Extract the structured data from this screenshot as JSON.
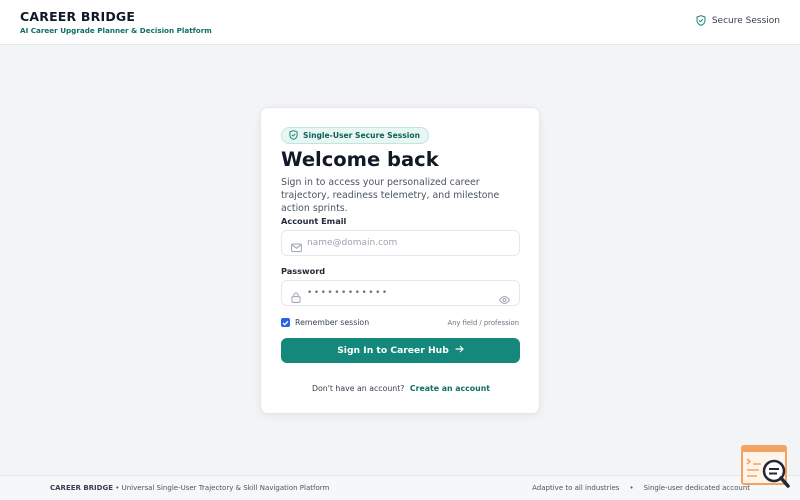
{
  "header": {
    "title": "CAREER BRIDGE",
    "subtitle": "AI Career Upgrade Planner & Decision Platform",
    "secure_label": "Secure Session",
    "secure_icon": "shield-check-icon"
  },
  "card": {
    "pill": "Single-User Secure Session",
    "heading": "Welcome back",
    "description": "Sign in to access your personalized career trajectory, readiness telemetry, and milestone action sprints.",
    "email": {
      "label": "Account Email",
      "placeholder": "name@domain.com",
      "value": "",
      "icon": "mail-icon"
    },
    "password": {
      "label": "Password",
      "value": "••••••••••••",
      "icon": "lock-icon",
      "toggle_icon": "eye-icon"
    },
    "remember": {
      "label": "Remember session",
      "checked": true
    },
    "hint": "Any field / profession",
    "signin_label": "Sign In to Career Hub",
    "signup_prompt": "Don't have an account?",
    "signup_link": "Create an account"
  },
  "footer": {
    "brand": "CAREER BRIDGE",
    "tagline": "Universal Single-User Trajectory & Skill Navigation Platform",
    "right_items": [
      "Adaptive to all industries",
      "•",
      "Single-user dedicated account"
    ]
  },
  "colors": {
    "accent": "#14887a",
    "accent_dark": "#0f6e62",
    "badge_orange": "#f4a261"
  }
}
